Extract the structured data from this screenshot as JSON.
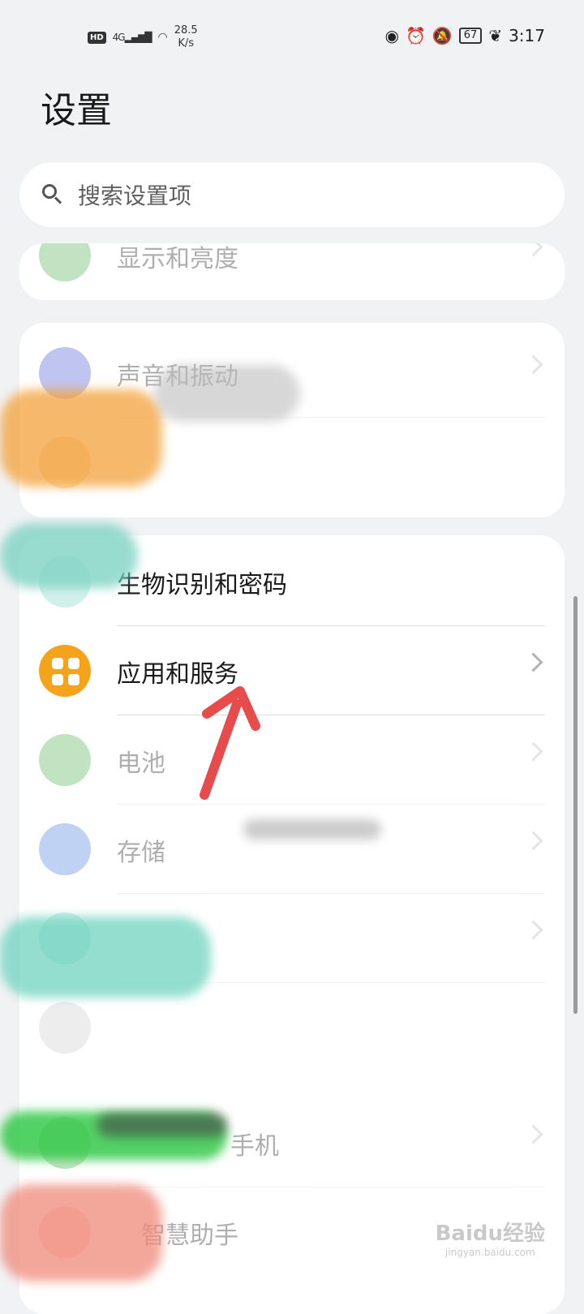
{
  "status_bar": {
    "hd": "HD",
    "signal": "4G",
    "speed_value": "28.5",
    "speed_unit": "K/s",
    "battery": "67",
    "time": "3:17"
  },
  "page": {
    "title": "设置"
  },
  "search": {
    "placeholder": "搜索设置项"
  },
  "items": [
    {
      "label": "显示和亮度",
      "icon": "eye-icon",
      "color": "#4caf50"
    },
    {
      "label": "声音和振动",
      "icon": "speaker-icon",
      "color": "#4a55d6"
    },
    {
      "label": "",
      "icon": "",
      "color": "#f2a73a"
    },
    {
      "label": "生物识别和密码",
      "icon": "fingerprint-icon",
      "color": "#7fd3c4"
    },
    {
      "label": "应用和服务",
      "icon": "apps-grid-icon",
      "color": "#f5a31a"
    },
    {
      "label": "电池",
      "icon": "battery-icon",
      "color": "#4caf50"
    },
    {
      "label": "存储",
      "icon": "storage-icon",
      "color": "#4a7fe0"
    },
    {
      "label": "",
      "icon": "",
      "color": "#6fd3c0"
    },
    {
      "label": "",
      "icon": "",
      "color": "#cccccc"
    },
    {
      "label": "手机",
      "icon": "",
      "color": "#4caf50"
    },
    {
      "label": "智慧助手",
      "icon": "",
      "color": "#f08a7a"
    }
  ],
  "watermark": {
    "main": "Baidu经验",
    "sub": "jingyan.baidu.com"
  }
}
